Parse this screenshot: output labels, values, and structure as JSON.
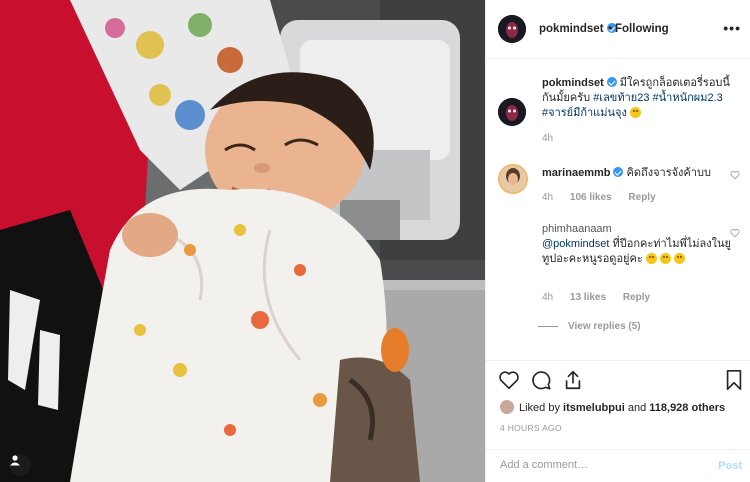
{
  "post": {
    "username": "pokmindset",
    "follow_status": "Following",
    "separator": "•",
    "more": "•••",
    "caption": {
      "text": "มีใครถูกล็อตเตอรี่รอบนี้กันมั้ยครับ",
      "hashtags": [
        "#เลขท้าย23",
        "#น้ำหนักผม2.3",
        "#จารย์มีก้าแม่นจุง"
      ],
      "time": "4h"
    }
  },
  "comments": [
    {
      "username": "marinaemmb",
      "verified": true,
      "text": "คิดถึงจารจังค้าบบ",
      "time": "4h",
      "likes": "106 likes",
      "reply": "Reply"
    },
    {
      "username": "phimhaanaam",
      "mention": "@pokmindset",
      "text": "ที่ปีอกคะท่าไมพี่ไม่ลงในยูทูปอะคะหนูรอดูอยู่คะ",
      "time": "4h",
      "likes": "13 likes",
      "reply": "Reply",
      "view_replies": "View replies (5)"
    }
  ],
  "engagement": {
    "liked_by_prefix": "Liked by",
    "liked_by_user": "itsmelubpui",
    "liked_by_and": "and",
    "like_count": "118,928 others",
    "timestamp": "4 HOURS AGO"
  },
  "composer": {
    "placeholder": "Add a comment…",
    "post_label": "Post"
  },
  "icons": [
    "heart-icon",
    "comment-icon",
    "share-icon",
    "bookmark-icon",
    "verified-icon",
    "more-icon",
    "user-tag-icon"
  ],
  "colors": {
    "link": "#003569",
    "verified": "#3897f0",
    "muted": "#999999",
    "post_disabled": "#b2dffc"
  }
}
